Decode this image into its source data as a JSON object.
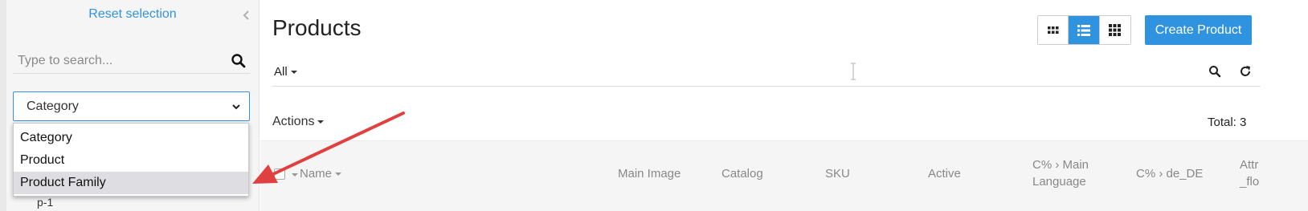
{
  "sidebar": {
    "reset_label": "Reset selection",
    "search": {
      "placeholder": "Type to search...",
      "value": ""
    },
    "select": {
      "value": "Category",
      "options": [
        "Category",
        "Product",
        "Product Family"
      ],
      "highlighted": "Product Family"
    },
    "tree_fragment": "p-1"
  },
  "main": {
    "title": "Products",
    "view_buttons": [
      {
        "name": "small-grid-icon",
        "active": false
      },
      {
        "name": "list-icon",
        "active": true
      },
      {
        "name": "large-grid-icon",
        "active": false
      }
    ],
    "create_label": "Create Product",
    "filter": {
      "label": "All"
    },
    "actions_label": "Actions",
    "total_label": "Total:",
    "total_value": "3",
    "columns": {
      "name": "Name",
      "main_image": "Main Image",
      "catalog": "Catalog",
      "sku": "SKU",
      "active": "Active",
      "main_language_1": "C% › Main",
      "main_language_2": "Language",
      "de_de": "C% › de_DE",
      "attr_1": "Attr",
      "attr_2": "_flo"
    }
  },
  "colors": {
    "accent": "#2f93e0",
    "annotation_arrow": "#e04040"
  }
}
